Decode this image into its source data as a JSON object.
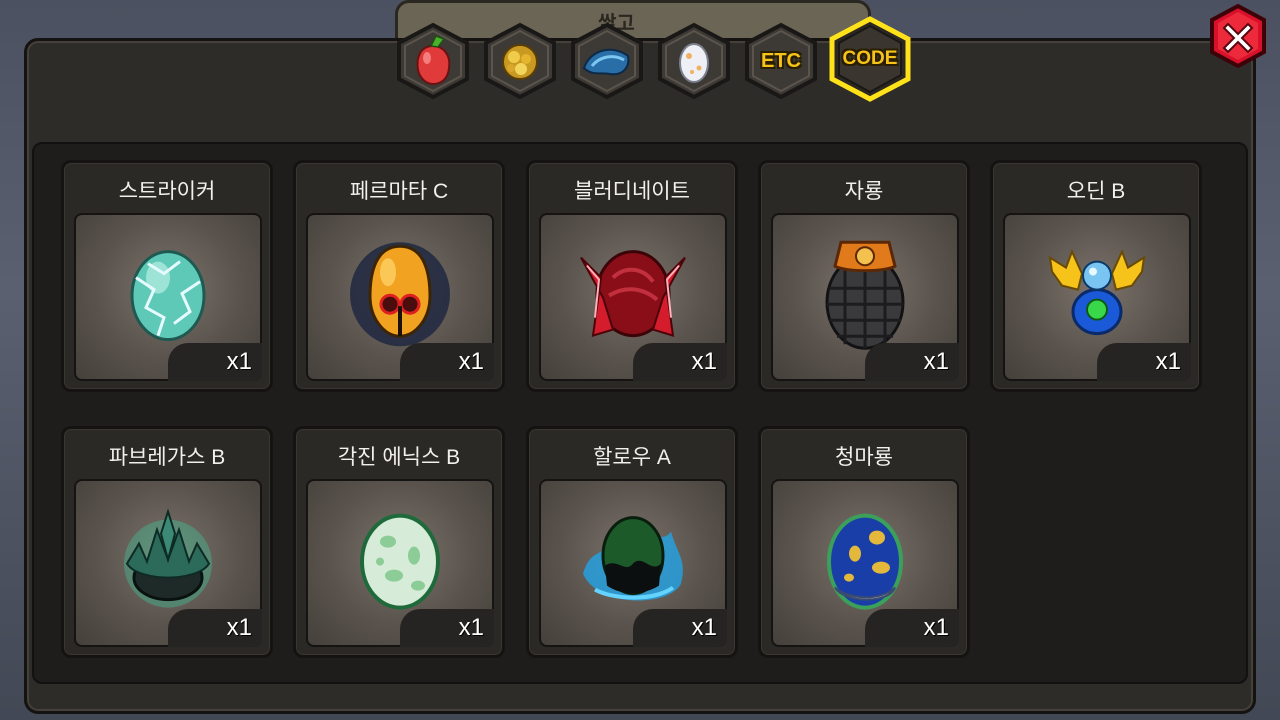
{
  "tabs": [
    {
      "name": "fruit",
      "icon": "red-fruit-icon",
      "label": ""
    },
    {
      "name": "ore",
      "icon": "gold-ore-icon",
      "label": ""
    },
    {
      "name": "scale",
      "icon": "blue-scale-icon",
      "label": ""
    },
    {
      "name": "egg",
      "icon": "egg-icon",
      "label": ""
    },
    {
      "name": "etc",
      "icon": "",
      "label": "ETC"
    },
    {
      "name": "code",
      "icon": "",
      "label": "CODE",
      "selected": true
    }
  ],
  "background_title": "쌓고",
  "items": [
    {
      "name": "스트라이커",
      "qty": "x1",
      "icon": "ice-egg-icon"
    },
    {
      "name": "페르마타 C",
      "qty": "x1",
      "icon": "bell-egg-icon"
    },
    {
      "name": "블러디네이트",
      "qty": "x1",
      "icon": "red-crystal-egg-icon"
    },
    {
      "name": "자룡",
      "qty": "x1",
      "icon": "grenade-egg-icon"
    },
    {
      "name": "오딘 B",
      "qty": "x1",
      "icon": "golden-orb-egg-icon"
    },
    {
      "name": "파브레가스 B",
      "qty": "x1",
      "icon": "spiked-green-egg-icon"
    },
    {
      "name": "각진 에닉스 B",
      "qty": "x1",
      "icon": "spotted-green-egg-icon"
    },
    {
      "name": "할로우 A",
      "qty": "x1",
      "icon": "shadow-flame-egg-icon"
    },
    {
      "name": "청마룡",
      "qty": "x1",
      "icon": "blue-dragon-egg-icon"
    }
  ],
  "colors": {
    "accent": "#f7c31a",
    "close": "#d8102a"
  }
}
